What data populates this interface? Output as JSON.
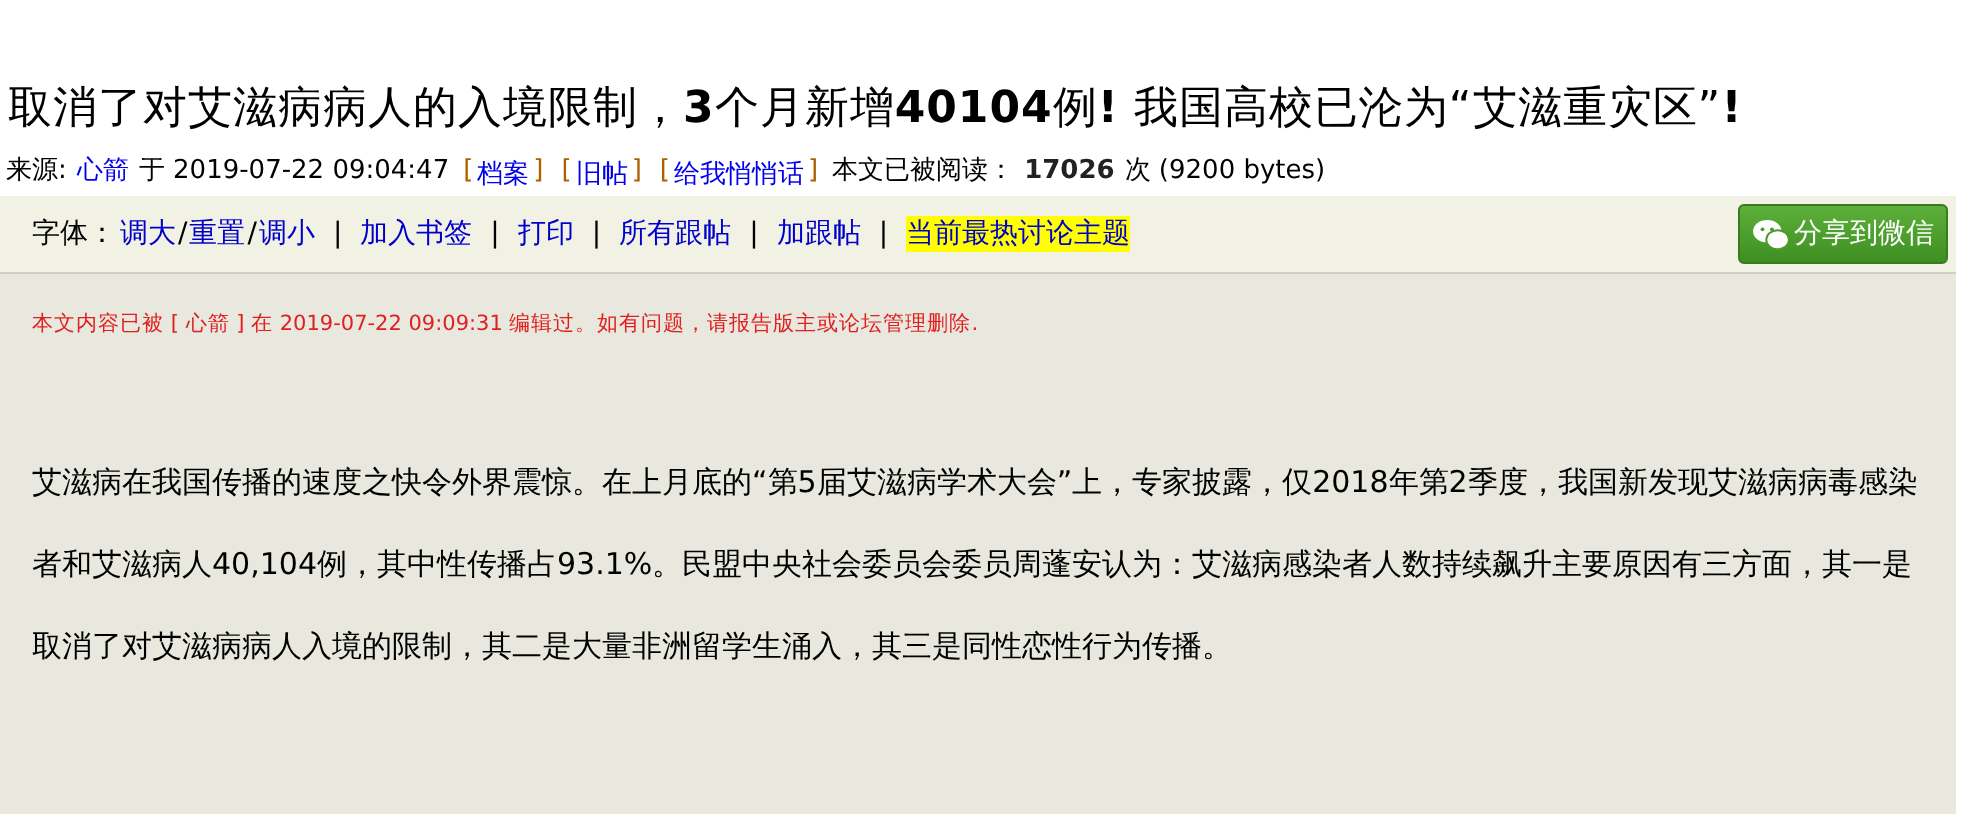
{
  "title": "取消了对艾滋病病人的入境限制，**3**个月新增**40104**例**!** 我国高校已沦为“艾滋重灾区”**!**",
  "meta": [
    {
      "kind": "text",
      "text": "来源:"
    },
    {
      "kind": "link",
      "text": "心箭"
    },
    {
      "kind": "text",
      "text": "于 2019-07-22 09:04:47"
    },
    {
      "kind": "bracket",
      "open": "[",
      "text": "档案",
      "close": "]"
    },
    {
      "kind": "bracket",
      "open": "[",
      "text": "旧帖",
      "close": "]"
    },
    {
      "kind": "bracket",
      "open": "[",
      "text": "给我悄悄话",
      "close": "]"
    },
    {
      "kind": "text",
      "text": "本文已被阅读："
    },
    {
      "kind": "bold",
      "text": "17026"
    },
    {
      "kind": "text",
      "text": "次 (9200 bytes)"
    }
  ],
  "toolbar": {
    "label": "字体：",
    "items": [
      {
        "kind": "link",
        "text": "调大",
        "highlighted": false
      },
      {
        "kind": "sep",
        "text": "/"
      },
      {
        "kind": "link",
        "text": "重置",
        "highlighted": false
      },
      {
        "kind": "sep",
        "text": "/"
      },
      {
        "kind": "link",
        "text": "调小",
        "highlighted": false
      },
      {
        "kind": "sep",
        "text": "|"
      },
      {
        "kind": "link",
        "text": "加入书签",
        "highlighted": false
      },
      {
        "kind": "sep",
        "text": "|"
      },
      {
        "kind": "link",
        "text": "打印",
        "highlighted": false
      },
      {
        "kind": "sep",
        "text": "|"
      },
      {
        "kind": "link",
        "text": "所有跟帖",
        "highlighted": false
      },
      {
        "kind": "sep",
        "text": "|"
      },
      {
        "kind": "link",
        "text": "加跟帖",
        "highlighted": false
      },
      {
        "kind": "sep",
        "text": "|"
      },
      {
        "kind": "link",
        "text": "当前最热讨论主题",
        "highlighted": true
      }
    ],
    "share_button": "分享到微信"
  },
  "edit_notice": "本文内容已被 [ 心箭 ] 在 2019-07-22 09:09:31 编辑过。如有问题，请报告版主或论坛管理删除.",
  "body": "艾滋病在我国传播的速度之快令外界震惊。在上月底的“第5届艾滋病学术大会”上，专家披露，仅2018年第2季度，我国新发现艾滋病病毒感染者和艾滋病人40,104例，其中性传播占93.1%。民盟中央社会委员会委员周蓬安认为：艾滋病感染者人数持续飙升主要原因有三方面，其一是取消了对艾滋病病人入境的限制，其二是大量非洲留学生涌入，其三是同性恋性行为传播。"
}
